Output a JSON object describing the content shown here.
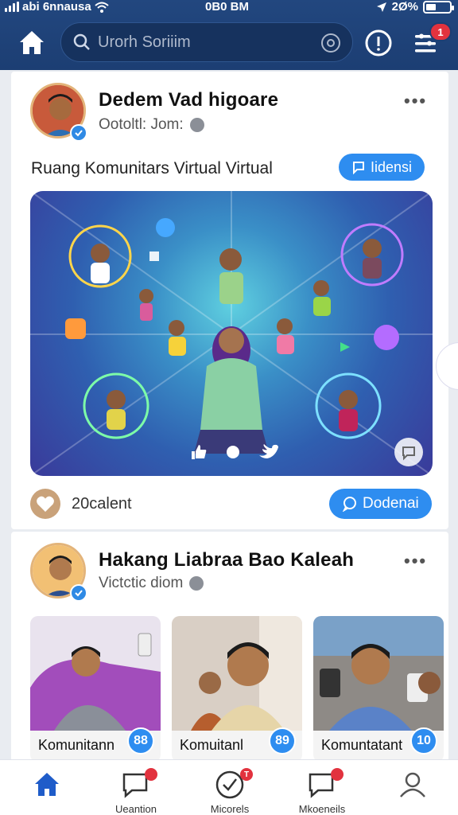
{
  "status_bar": {
    "carrier": "abi 6nnausa",
    "time": "0B0 BM",
    "battery_pct": "2Ø%"
  },
  "header": {
    "search_placeholder": "Urorh Soriiim",
    "menu_badge": "1"
  },
  "post1": {
    "author": "Dedem Vad  higoare",
    "meta": "Ootoltl: Jom:",
    "caption": "Ruang Komunitars Virtual Virtual",
    "action_label": "Iidensi",
    "likes": "20calent",
    "reply_label": "Dodenai"
  },
  "post2": {
    "author": "Hakang Liabraa Bao Kaleah",
    "meta": "Victctic diom",
    "thumbs": [
      {
        "label": "Komunitann",
        "count": "88"
      },
      {
        "label": "Komuitanl",
        "count": "89"
      },
      {
        "label": "Komuntatant",
        "count": "10"
      }
    ]
  },
  "nav": {
    "items": [
      {
        "label": "",
        "icon": "home-icon",
        "active": true
      },
      {
        "label": "Ueantion",
        "icon": "chat-icon",
        "badge": ""
      },
      {
        "label": "Micorels",
        "icon": "check-circle-icon",
        "badge": "T"
      },
      {
        "label": "Mkoeneils",
        "icon": "chat-icon",
        "badge": ""
      },
      {
        "label": "",
        "icon": "profile-icon"
      }
    ]
  },
  "colors": {
    "header_bg": "#1c3e73",
    "accent": "#2e8df0",
    "badge": "#e2323e"
  }
}
